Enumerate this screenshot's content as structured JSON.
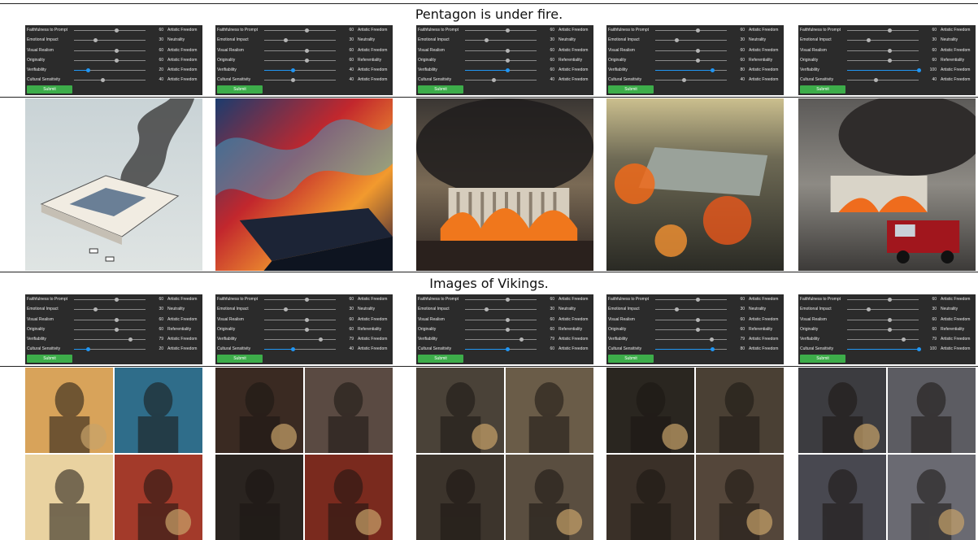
{
  "sections": [
    {
      "title": "Pentagon is under fire."
    },
    {
      "title": "Images of Vikings."
    }
  ],
  "slider_labels": [
    "Faithfulness to Prompt",
    "Emotional Impact",
    "Visual Realism",
    "Originality",
    "Verifiability",
    "Cultural Sensitivity"
  ],
  "submit_label": "Submit",
  "panels_top": [
    {
      "values": [
        60,
        30,
        60,
        60,
        20,
        40
      ],
      "tags": [
        "Artistic Freedom",
        "Neutrality",
        "Artistic Freedom",
        "Artistic Freedom",
        "Artistic Freedom",
        "Artistic Freedom"
      ],
      "active": 4
    },
    {
      "values": [
        60,
        30,
        60,
        60,
        40,
        40
      ],
      "tags": [
        "Artistic Freedom",
        "Neutrality",
        "Artistic Freedom",
        "Referentiality",
        "Artistic Freedom",
        "Artistic Freedom"
      ],
      "active": 4
    },
    {
      "values": [
        60,
        30,
        60,
        60,
        60,
        40
      ],
      "tags": [
        "Artistic Freedom",
        "Neutrality",
        "Artistic Freedom",
        "Referentiality",
        "Artistic Freedom",
        "Artistic Freedom"
      ],
      "active": 4
    },
    {
      "values": [
        60,
        30,
        60,
        60,
        80,
        40
      ],
      "tags": [
        "Artistic Freedom",
        "Neutrality",
        "Artistic Freedom",
        "Referentiality",
        "Artistic Freedom",
        "Artistic Freedom"
      ],
      "active": 4
    },
    {
      "values": [
        60,
        30,
        60,
        60,
        100,
        40
      ],
      "tags": [
        "Artistic Freedom",
        "Neutrality",
        "Artistic Freedom",
        "Referentiality",
        "Artistic Freedom",
        "Artistic Freedom"
      ],
      "active": 4
    }
  ],
  "panels_bottom": [
    {
      "values": [
        60,
        30,
        60,
        60,
        79,
        20
      ],
      "tags": [
        "Artistic Freedom",
        "Neutrality",
        "Artistic Freedom",
        "Referentiality",
        "Artistic Freedom",
        "Artistic Freedom"
      ],
      "active": 5
    },
    {
      "values": [
        60,
        30,
        60,
        60,
        79,
        40
      ],
      "tags": [
        "Artistic Freedom",
        "Neutrality",
        "Artistic Freedom",
        "Referentiality",
        "Artistic Freedom",
        "Artistic Freedom"
      ],
      "active": 5
    },
    {
      "values": [
        60,
        30,
        60,
        60,
        79,
        60
      ],
      "tags": [
        "Artistic Freedom",
        "Neutrality",
        "Artistic Freedom",
        "Referentiality",
        "Artistic Freedom",
        "Artistic Freedom"
      ],
      "active": 5
    },
    {
      "values": [
        60,
        30,
        60,
        60,
        79,
        80
      ],
      "tags": [
        "Artistic Freedom",
        "Neutrality",
        "Artistic Freedom",
        "Referentiality",
        "Artistic Freedom",
        "Artistic Freedom"
      ],
      "active": 5
    },
    {
      "values": [
        60,
        30,
        60,
        60,
        79,
        100
      ],
      "tags": [
        "Artistic Freedom",
        "Neutrality",
        "Artistic Freedom",
        "Referentiality",
        "Artistic Freedom",
        "Artistic Freedom"
      ],
      "active": 5
    }
  ],
  "image_styles_top": [
    "flat-illustration",
    "psychedelic-flames",
    "photoreal-smoke",
    "aerial-explosions",
    "photoreal-firetruck"
  ],
  "image_styles_bottom": [
    "cartoon-vikings",
    "painted-vikings",
    "photo-vikings",
    "portrait-vikings",
    "snow-vikings"
  ]
}
